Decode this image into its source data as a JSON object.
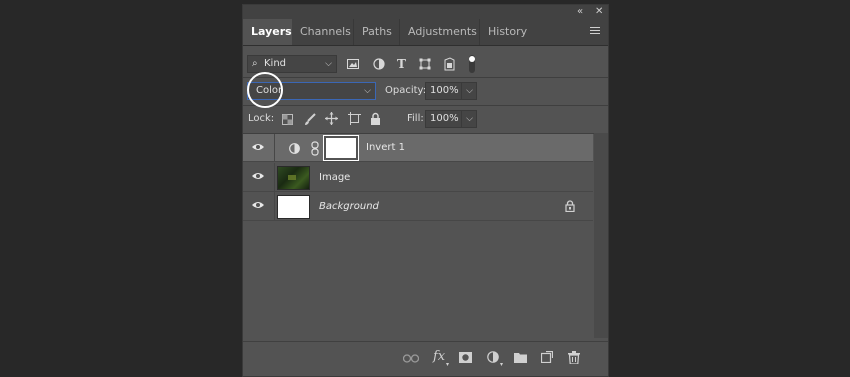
{
  "tabs": [
    {
      "label": "Layers",
      "active": true
    },
    {
      "label": "Channels",
      "active": false
    },
    {
      "label": "Paths",
      "active": false
    },
    {
      "label": "Adjustments",
      "active": false
    },
    {
      "label": "History",
      "active": false
    }
  ],
  "window_controls": {
    "collapse": "«",
    "close": "✕"
  },
  "filter": {
    "kind_label": "Kind",
    "icons": [
      "image-filter-icon",
      "adjustment-filter-icon",
      "type-filter-icon",
      "shape-filter-icon",
      "smart-object-filter-icon",
      "filter-toggle-icon"
    ]
  },
  "blend": {
    "mode": "Color",
    "opacity_label": "Opacity:",
    "opacity_value": "100%"
  },
  "lock": {
    "label": "Lock:",
    "fill_label": "Fill:",
    "fill_value": "100%"
  },
  "layers": [
    {
      "name": "Invert 1",
      "type": "adjustment",
      "selected": true,
      "italic": false
    },
    {
      "name": "Image",
      "type": "pixel",
      "selected": false,
      "italic": false
    },
    {
      "name": "Background",
      "type": "background",
      "selected": false,
      "italic": true,
      "locked": true
    }
  ],
  "footer_icons": [
    "link-layers-icon",
    "fx-icon",
    "add-mask-icon",
    "new-adjustment-icon",
    "new-group-icon",
    "new-layer-icon",
    "delete-layer-icon"
  ],
  "fx_label": "fx",
  "colors": {
    "panel": "#535353",
    "selected_layer": "#6a6a6a",
    "highlight_ring": "#ffffff",
    "blend_border": "#3b67b5"
  }
}
